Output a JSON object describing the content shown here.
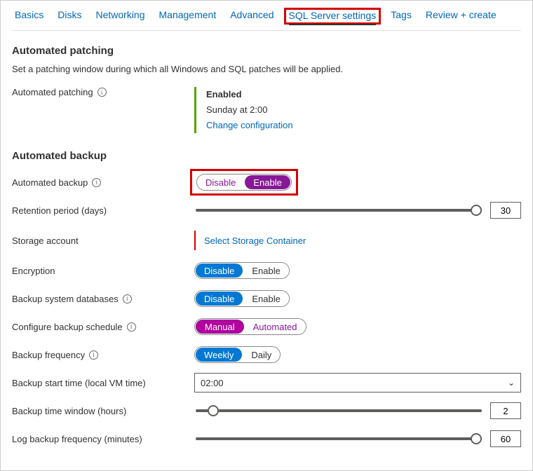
{
  "tabs": {
    "basics": "Basics",
    "disks": "Disks",
    "networking": "Networking",
    "management": "Management",
    "advanced": "Advanced",
    "sql": "SQL Server settings",
    "tags": "Tags",
    "review": "Review + create"
  },
  "patching": {
    "heading": "Automated patching",
    "desc": "Set a patching window during which all Windows and SQL patches will be applied.",
    "label": "Automated patching",
    "status": "Enabled",
    "schedule": "Sunday at 2:00",
    "change_link": "Change configuration"
  },
  "backup": {
    "heading": "Automated backup",
    "auto_label": "Automated backup",
    "toggle": {
      "disable": "Disable",
      "enable": "Enable"
    },
    "retention_label": "Retention period (days)",
    "retention_value": "30",
    "storage_label": "Storage account",
    "storage_link": "Select Storage Container",
    "encryption_label": "Encryption",
    "enc_toggle": {
      "disable": "Disable",
      "enable": "Enable"
    },
    "sysdb_label": "Backup system databases",
    "sysdb_toggle": {
      "disable": "Disable",
      "enable": "Enable"
    },
    "schedule_label": "Configure backup schedule",
    "schedule_toggle": {
      "manual": "Manual",
      "automated": "Automated"
    },
    "freq_label": "Backup frequency",
    "freq_toggle": {
      "weekly": "Weekly",
      "daily": "Daily"
    },
    "start_label": "Backup start time (local VM time)",
    "start_value": "02:00",
    "window_label": "Backup time window (hours)",
    "window_value": "2",
    "logfreq_label": "Log backup frequency (minutes)",
    "logfreq_value": "60"
  }
}
